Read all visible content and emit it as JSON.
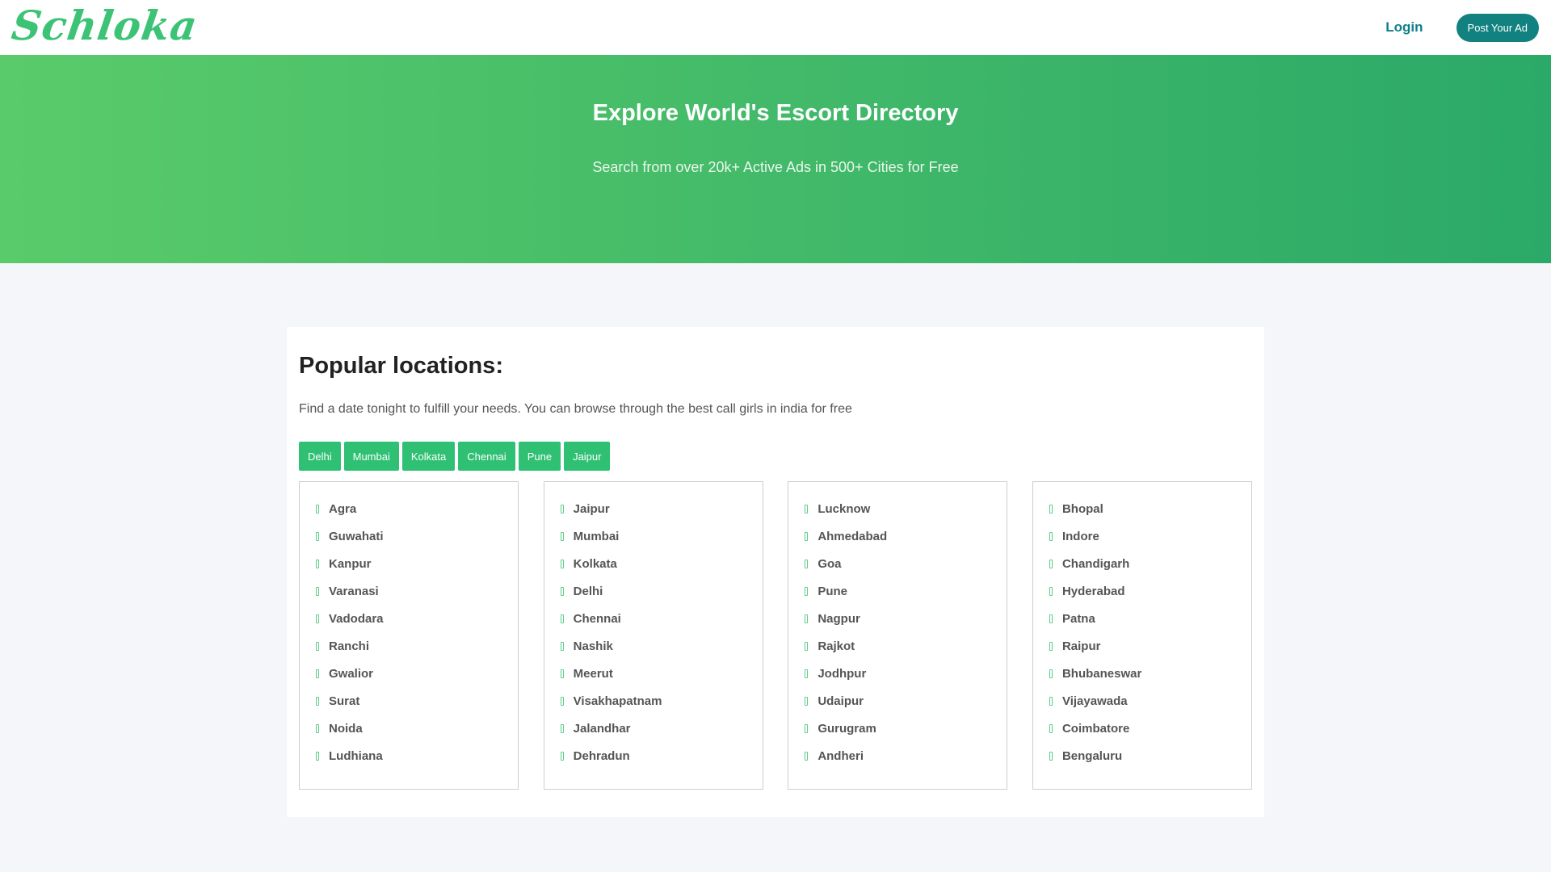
{
  "header": {
    "logo_text": "Schloka",
    "login_label": "Login",
    "post_ad_label": "Post Your Ad"
  },
  "hero": {
    "title": "Explore World's Escort Directory",
    "subtitle": "Search from over 20k+ Active Ads in 500+ Cities for Free"
  },
  "popular": {
    "heading": "Popular locations:",
    "description": "Find a date tonight to fulfill your needs. You can browse through the best call girls in india for free",
    "chips": [
      "Delhi",
      "Mumbai",
      "Kolkata",
      "Chennai",
      "Pune",
      "Jaipur"
    ],
    "columns": [
      [
        "Agra",
        "Guwahati",
        "Kanpur",
        "Varanasi",
        "Vadodara",
        "Ranchi",
        "Gwalior",
        "Surat",
        "Noida",
        "Ludhiana"
      ],
      [
        "Jaipur",
        "Mumbai",
        "Kolkata",
        "Delhi",
        "Chennai",
        "Nashik",
        "Meerut",
        "Visakhapatnam",
        "Jalandhar",
        "Dehradun"
      ],
      [
        "Lucknow",
        "Ahmedabad",
        "Goa",
        "Pune",
        "Nagpur",
        "Rajkot",
        "Jodhpur",
        "Udaipur",
        "Gurugram",
        "Andheri"
      ],
      [
        "Bhopal",
        "Indore",
        "Chandigarh",
        "Hyderabad",
        "Patna",
        "Raipur",
        "Bhubaneswar",
        "Vijayawada",
        "Coimbatore",
        "Bengaluru"
      ]
    ]
  },
  "colors": {
    "brand_green": "#3cc376",
    "accent_teal": "#11827f",
    "chip_green": "#2fc073",
    "hero_gradient_start": "#5acb6a",
    "hero_gradient_end": "#2ba968"
  }
}
